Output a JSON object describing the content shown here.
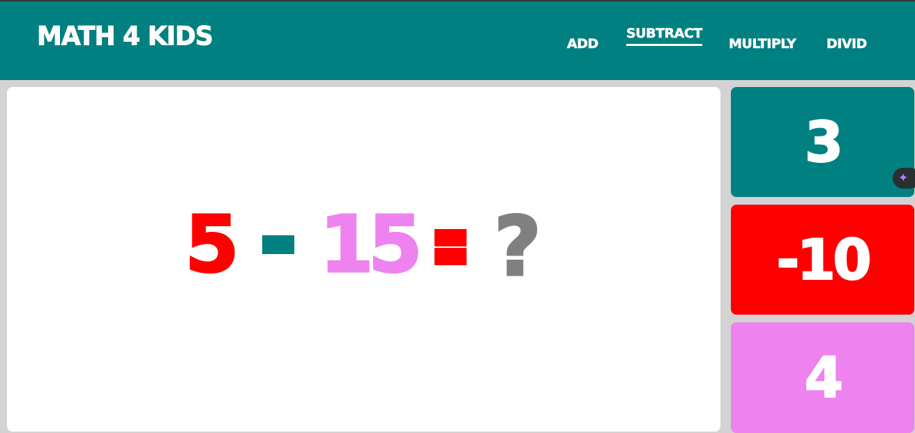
{
  "app": {
    "title": "MATH 4 KIDS"
  },
  "nav": {
    "items": [
      {
        "label": "ADD",
        "active": false
      },
      {
        "label": "SUBTRACT",
        "active": true
      },
      {
        "label": "MULTIPLY",
        "active": false
      },
      {
        "label": "DIVID",
        "active": false
      }
    ]
  },
  "problem": {
    "operand_a": "5",
    "operator": "minus",
    "operand_b": "15",
    "equals": "equals",
    "unknown": "?"
  },
  "answers": [
    {
      "value": "3",
      "color": "#008080"
    },
    {
      "value": "-10",
      "color": "#ff0000"
    },
    {
      "value": "4",
      "color": "#ee82ee"
    }
  ],
  "colors": {
    "header": "#008080",
    "background": "#d3d3d3",
    "board": "#ffffff",
    "operand_a": "#ff0000",
    "operand_b": "#ee82ee",
    "operator": "#008080",
    "equals": "#ff0000",
    "unknown": "#808080"
  },
  "assistant": {
    "icon": "sparkle-icon"
  }
}
